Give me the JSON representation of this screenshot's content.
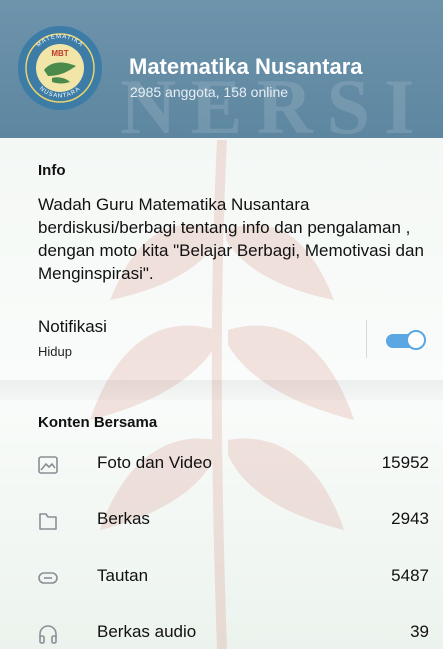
{
  "header": {
    "group_name": "Matematika Nusantara",
    "members": "2985 anggota, 158 online",
    "watermark_text": "NERSI",
    "avatar": {
      "ring_text_top": "MATEMATIKA",
      "ring_text_bottom": "NUSANTARA",
      "badge_text": "MBT"
    }
  },
  "info": {
    "section_title": "Info",
    "description": "Wadah Guru Matematika Nusantara berdiskusi/berbagi tentang info dan pengalaman , dengan moto kita \"Belajar Berbagi, Memotivasi dan Menginspirasi\".",
    "notifications": {
      "label": "Notifikasi",
      "status": "Hidup",
      "enabled": true
    }
  },
  "shared_content": {
    "section_title": "Konten Bersama",
    "items": [
      {
        "icon": "image-icon",
        "label": "Foto dan Video",
        "count": "15952"
      },
      {
        "icon": "file-icon",
        "label": "Berkas",
        "count": "2943"
      },
      {
        "icon": "link-icon",
        "label": "Tautan",
        "count": "5487"
      },
      {
        "icon": "headphones-icon",
        "label": "Berkas audio",
        "count": "39"
      }
    ]
  },
  "colors": {
    "header_bg": "#6485a0",
    "toggle_accent": "#5aa7e4"
  }
}
